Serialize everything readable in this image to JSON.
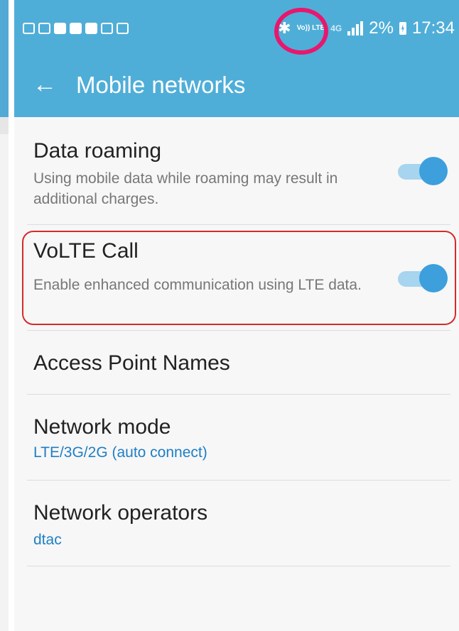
{
  "status_bar": {
    "volte_badge": "Vo)) LTE",
    "network_type": "4G",
    "battery_percent": "2%",
    "time": "17:34",
    "notification_icons": [
      "download-icon",
      "image-icon",
      "mail-icon",
      "youtube-icon",
      "youtube-icon",
      "voicemail-icon",
      "briefcase-icon"
    ]
  },
  "app_bar": {
    "title": "Mobile networks",
    "back_icon": "arrow-left-icon"
  },
  "settings": {
    "data_roaming": {
      "title": "Data roaming",
      "summary": "Using mobile data while roaming may result in additional charges.",
      "enabled": true
    },
    "volte_call": {
      "title": "VoLTE Call",
      "summary": "Enable enhanced communication using LTE data.",
      "enabled": true
    },
    "access_point_names": {
      "title": "Access Point Names"
    },
    "network_mode": {
      "title": "Network mode",
      "value": "LTE/3G/2G (auto connect)"
    },
    "network_operators": {
      "title": "Network operators",
      "value": "dtac"
    }
  },
  "colors": {
    "accent": "#4faed8",
    "toggle": "#3d9fdc",
    "highlight_ring": "#e8176d",
    "highlight_box": "#d62a2a",
    "value_text": "#1e7fc4"
  }
}
